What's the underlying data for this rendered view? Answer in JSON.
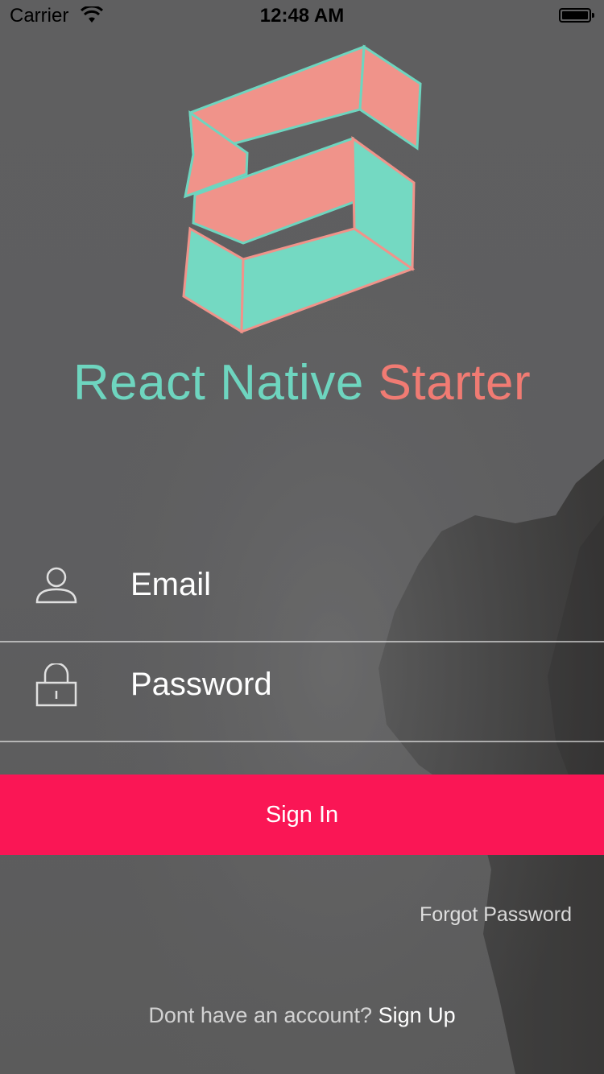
{
  "status_bar": {
    "carrier": "Carrier",
    "time": "12:48 AM",
    "wifi_icon": "wifi-icon",
    "battery_icon": "battery-icon"
  },
  "branding": {
    "logo_icon": "react-native-starter-logo",
    "title_part1": "React Native ",
    "title_part2": "Starter",
    "color_teal": "#6ed5bf",
    "color_coral": "#f07b73"
  },
  "form": {
    "email": {
      "placeholder": "Email",
      "icon": "user-icon"
    },
    "password": {
      "placeholder": "Password",
      "icon": "lock-icon"
    },
    "sign_in_label": "Sign In",
    "sign_in_color": "#fa1655"
  },
  "links": {
    "forgot_password": "Forgot Password",
    "no_account_prompt": "Dont have an account? ",
    "sign_up": "Sign Up"
  }
}
